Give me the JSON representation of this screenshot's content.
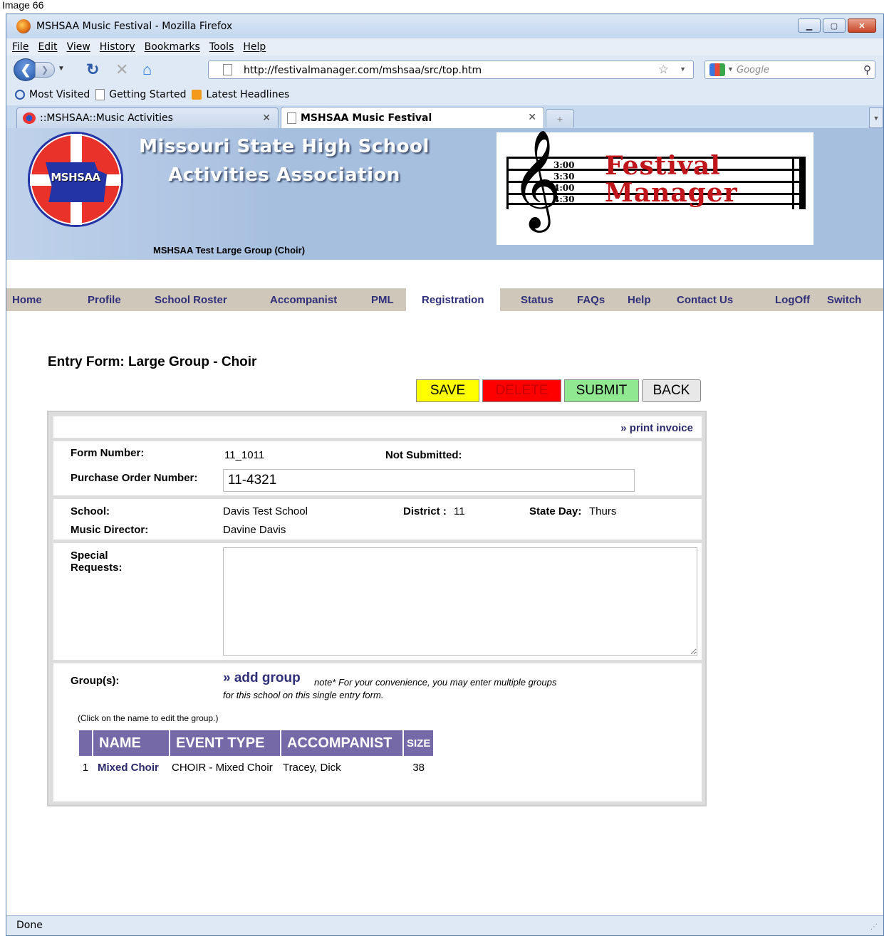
{
  "top_strip": "Image 66",
  "browser": {
    "window_title": "MSHSAA Music Festival - Mozilla Firefox",
    "menu": [
      "File",
      "Edit",
      "View",
      "History",
      "Bookmarks",
      "Tools",
      "Help"
    ],
    "url": "http://festivalmanager.com/mshsaa/src/top.htm",
    "search_placeholder": "Google",
    "bookmarks": [
      "Most Visited",
      "Getting Started",
      "Latest Headlines"
    ],
    "tabs": [
      {
        "label": "::MSHSAA::Music Activities",
        "active": false
      },
      {
        "label": "MSHSAA Music Festival",
        "active": true
      }
    ],
    "status": "Done",
    "icons": [
      "firefox-icon",
      "back-icon",
      "forward-icon",
      "reload-icon",
      "stop-icon",
      "home-icon",
      "star-icon",
      "search-icon",
      "rss-icon"
    ]
  },
  "header": {
    "seal_text": "MSHSAA",
    "org_line1": "Missouri State High School",
    "org_line2": "Activities Association",
    "group_title": "MSHSAA Test Large Group (Choir)",
    "fm_times": [
      "3:00",
      "3:30",
      "4:00",
      "4:30"
    ],
    "fm_line1": "Festival",
    "fm_line2": "Manager"
  },
  "nav": [
    {
      "label": "Home"
    },
    {
      "label": "Profile"
    },
    {
      "label": "School Roster"
    },
    {
      "label": "Accompanist"
    },
    {
      "label": "PML"
    },
    {
      "label": "Registration"
    },
    {
      "label": "Status"
    },
    {
      "label": "FAQs"
    },
    {
      "label": "Help"
    },
    {
      "label": "Contact Us"
    },
    {
      "label": "LogOff"
    },
    {
      "label": "Switch"
    }
  ],
  "form": {
    "title": "Entry Form: Large Group - Choir",
    "buttons": {
      "save": "SAVE",
      "delete": "DELETE",
      "submit": "SUBMIT",
      "back": "BACK"
    },
    "print_invoice": "» print invoice",
    "form_number_label": "Form Number:",
    "form_number": "11_1011",
    "submitted_label": "Not Submitted:",
    "po_label": "Purchase Order Number:",
    "po_value": "11-4321",
    "school_label": "School:",
    "school": "Davis Test School",
    "district_label": "District :",
    "district": "11",
    "state_day_label": "State Day:",
    "state_day": "Thurs",
    "director_label": "Music Director:",
    "director": "Davine Davis",
    "special_label_1": "Special",
    "special_label_2": "Requests:",
    "special_value": "",
    "groups_label": "Group(s):",
    "add_group": "» add group",
    "note": "note* For your convenience, you may enter multiple groups for this school on this single entry form.",
    "click_note": "(Click on the name to edit the group.)",
    "columns": [
      "NAME",
      "EVENT TYPE",
      "ACCOMPANIST",
      "SIZE"
    ],
    "groups": [
      {
        "num": "1",
        "name": "Mixed Choir",
        "event": "CHOIR - Mixed Choir",
        "accompanist": "Tracey, Dick",
        "size": "38"
      }
    ]
  }
}
